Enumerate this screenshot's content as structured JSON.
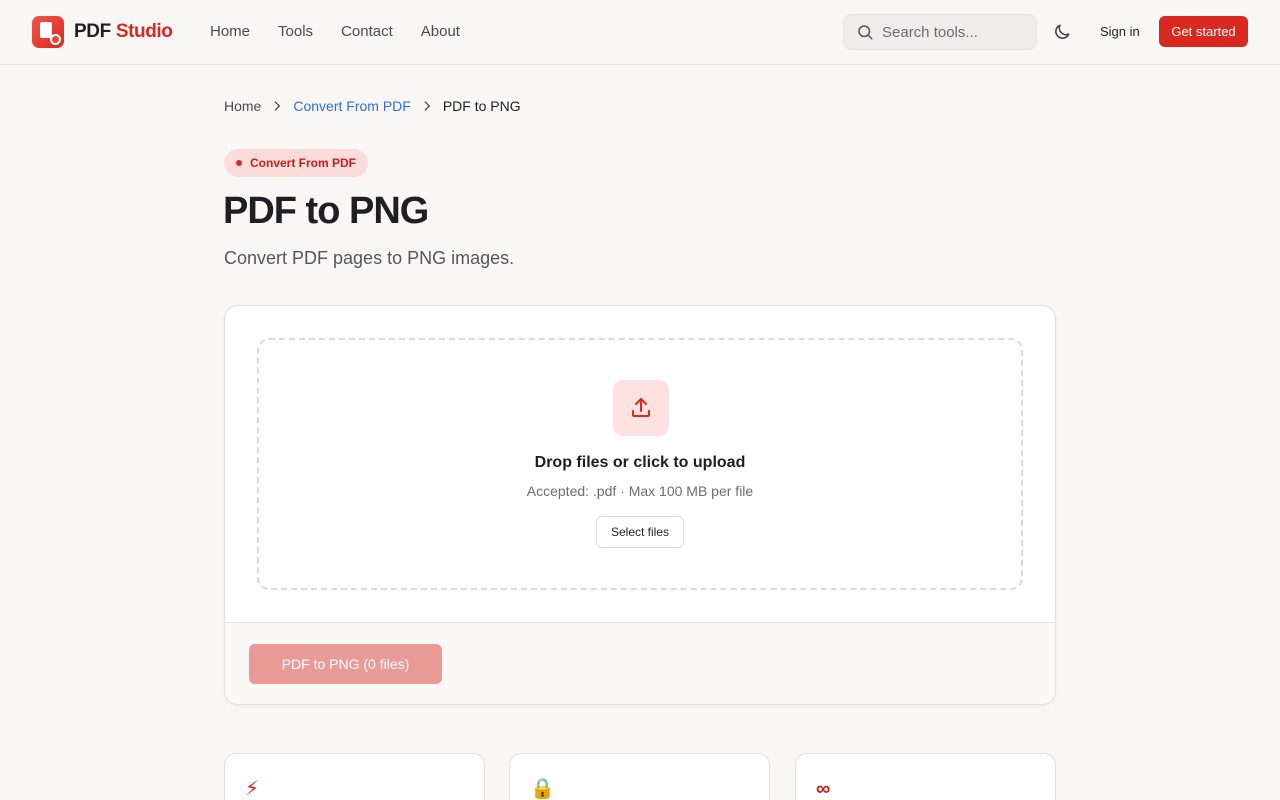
{
  "brand": {
    "name_part1": "PDF",
    "name_part2": "Studio",
    "accent_color": "#d9281f"
  },
  "nav": {
    "items": [
      {
        "label": "Home"
      },
      {
        "label": "Tools"
      },
      {
        "label": "Contact"
      },
      {
        "label": "About"
      }
    ]
  },
  "search": {
    "placeholder": "Search tools...",
    "icon": "search-icon"
  },
  "header_actions": {
    "theme_icon": "moon-icon",
    "sign_in_label": "Sign in",
    "get_started_label": "Get started"
  },
  "breadcrumb": {
    "items": [
      {
        "label": "Home"
      },
      {
        "label": "Convert From PDF"
      },
      {
        "label": "PDF to PNG"
      }
    ]
  },
  "page": {
    "category_badge": "Convert From PDF",
    "title": "PDF to PNG",
    "subtitle": "Convert PDF pages to PNG images."
  },
  "upload": {
    "title": "Drop files or click to upload",
    "accepted_text": "Accepted: .pdf · Max 100 MB per file",
    "select_label": "Select files",
    "icon": "upload-icon"
  },
  "action": {
    "convert_label": "PDF to PNG (0 files)"
  },
  "features": [
    {
      "icon": "lightning-icon",
      "glyph": "⚡"
    },
    {
      "icon": "lock-icon",
      "glyph": "🔒"
    },
    {
      "icon": "infinity-icon",
      "glyph": "∞"
    }
  ]
}
